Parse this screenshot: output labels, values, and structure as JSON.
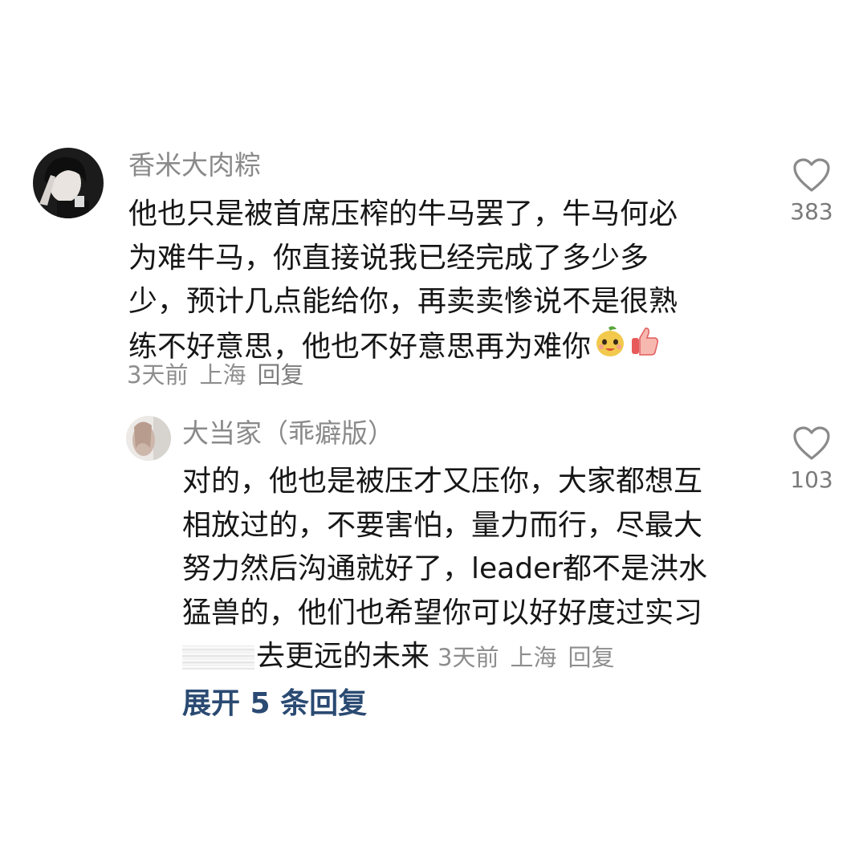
{
  "comments": [
    {
      "username": "香米大肉粽",
      "content_lines": [
        "他也只是被首席压榨的牛马罢了，牛马何必",
        "为难牛马，你直接说我已经完成了多少多",
        "少，预计几点能给你，再卖卖惨说不是很熟",
        "练不好意思，他也不好意思再为难你"
      ],
      "emojis": [
        "smile-pear-emoji",
        "thumbs-up-emoji"
      ],
      "time": "3天前",
      "location": "上海",
      "reply_label": "回复",
      "likes": "383"
    }
  ],
  "reply": {
    "username": "大当家（乖癖版）",
    "content_lines": [
      "对的，他也是被压才又压你，大家都想互",
      "相放过的，不要害怕，量力而行，尽最大",
      "努力然后沟通就好了，leader都不是洪水",
      "猛兽的，他们也希望你可以好好度过实习",
      "去更远的未来"
    ],
    "time": "3天前",
    "location": "上海",
    "reply_label": "回复",
    "likes": "103"
  },
  "expand_label": "展开 5 条回复",
  "colors": {
    "username": "#8a8a8a",
    "meta": "#8e8e8e",
    "expand": "#2a4a72",
    "heart_outline": "#8a8a8a"
  }
}
